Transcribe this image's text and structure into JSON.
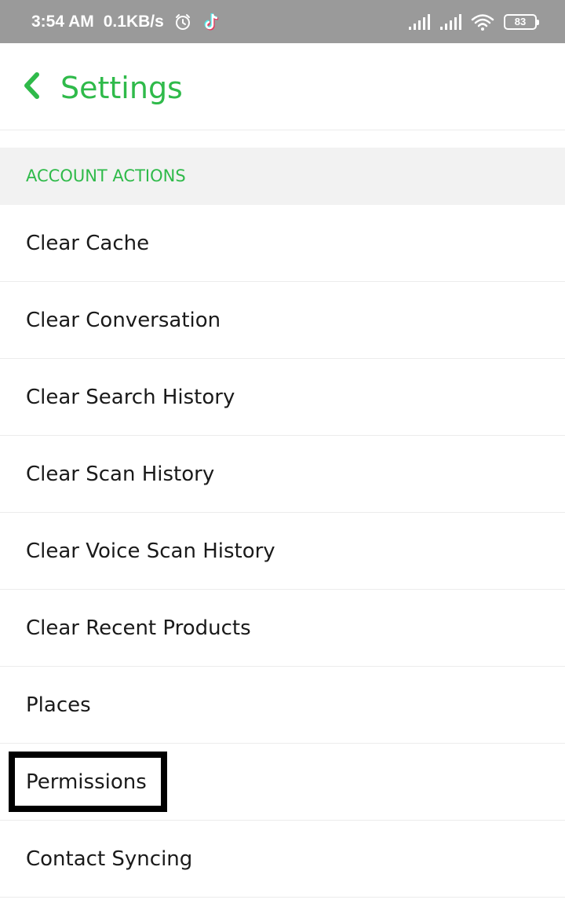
{
  "status_bar": {
    "time": "3:54 AM",
    "speed": "0.1KB/s",
    "battery": "83",
    "icons": [
      "alarm-icon",
      "tiktok-icon",
      "signal-icon",
      "signal-icon",
      "wifi-icon",
      "battery-icon"
    ]
  },
  "header": {
    "title": "Settings",
    "back_icon": "chevron-left-icon"
  },
  "section": {
    "title": "ACCOUNT ACTIONS"
  },
  "items": [
    {
      "label": "Clear Cache"
    },
    {
      "label": "Clear Conversation"
    },
    {
      "label": "Clear Search History"
    },
    {
      "label": "Clear Scan History"
    },
    {
      "label": "Clear Voice Scan History"
    },
    {
      "label": "Clear Recent Products"
    },
    {
      "label": "Places"
    },
    {
      "label": "Permissions"
    },
    {
      "label": "Contact Syncing"
    }
  ],
  "colors": {
    "accent": "#2fba4a",
    "status_bar": "#9a9a9a",
    "section_bg": "#f2f2f2",
    "highlight": "#000000"
  }
}
